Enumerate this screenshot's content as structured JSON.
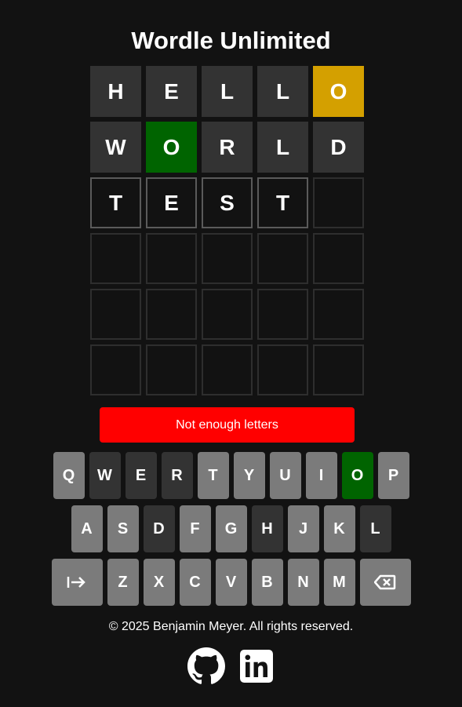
{
  "title": "Wordle Unlimited",
  "board": [
    [
      {
        "l": "H",
        "s": "absent"
      },
      {
        "l": "E",
        "s": "absent"
      },
      {
        "l": "L",
        "s": "absent"
      },
      {
        "l": "L",
        "s": "absent"
      },
      {
        "l": "O",
        "s": "present"
      }
    ],
    [
      {
        "l": "W",
        "s": "absent"
      },
      {
        "l": "O",
        "s": "correct"
      },
      {
        "l": "R",
        "s": "absent"
      },
      {
        "l": "L",
        "s": "absent"
      },
      {
        "l": "D",
        "s": "absent"
      }
    ],
    [
      {
        "l": "T",
        "s": "typed"
      },
      {
        "l": "E",
        "s": "typed"
      },
      {
        "l": "S",
        "s": "typed"
      },
      {
        "l": "T",
        "s": "typed"
      },
      {
        "l": "",
        "s": "empty"
      }
    ],
    [
      {
        "l": "",
        "s": "empty"
      },
      {
        "l": "",
        "s": "empty"
      },
      {
        "l": "",
        "s": "empty"
      },
      {
        "l": "",
        "s": "empty"
      },
      {
        "l": "",
        "s": "empty"
      }
    ],
    [
      {
        "l": "",
        "s": "empty"
      },
      {
        "l": "",
        "s": "empty"
      },
      {
        "l": "",
        "s": "empty"
      },
      {
        "l": "",
        "s": "empty"
      },
      {
        "l": "",
        "s": "empty"
      }
    ],
    [
      {
        "l": "",
        "s": "empty"
      },
      {
        "l": "",
        "s": "empty"
      },
      {
        "l": "",
        "s": "empty"
      },
      {
        "l": "",
        "s": "empty"
      },
      {
        "l": "",
        "s": "empty"
      }
    ]
  ],
  "message": "Not enough letters",
  "keyboard": {
    "row1": [
      {
        "k": "Q",
        "s": "unused"
      },
      {
        "k": "W",
        "s": "absent"
      },
      {
        "k": "E",
        "s": "absent"
      },
      {
        "k": "R",
        "s": "absent"
      },
      {
        "k": "T",
        "s": "unused"
      },
      {
        "k": "Y",
        "s": "unused"
      },
      {
        "k": "U",
        "s": "unused"
      },
      {
        "k": "I",
        "s": "unused"
      },
      {
        "k": "O",
        "s": "correct"
      },
      {
        "k": "P",
        "s": "unused"
      }
    ],
    "row2": [
      {
        "k": "A",
        "s": "unused"
      },
      {
        "k": "S",
        "s": "unused"
      },
      {
        "k": "D",
        "s": "absent"
      },
      {
        "k": "F",
        "s": "unused"
      },
      {
        "k": "G",
        "s": "unused"
      },
      {
        "k": "H",
        "s": "absent"
      },
      {
        "k": "J",
        "s": "unused"
      },
      {
        "k": "K",
        "s": "unused"
      },
      {
        "k": "L",
        "s": "absent"
      }
    ],
    "row3": [
      {
        "k": "Z",
        "s": "unused"
      },
      {
        "k": "X",
        "s": "unused"
      },
      {
        "k": "C",
        "s": "unused"
      },
      {
        "k": "V",
        "s": "unused"
      },
      {
        "k": "B",
        "s": "unused"
      },
      {
        "k": "N",
        "s": "unused"
      },
      {
        "k": "M",
        "s": "unused"
      }
    ],
    "enter_icon": "enter-arrow-icon",
    "backspace_icon": "backspace-icon"
  },
  "footer": "© 2025 Benjamin Meyer. All rights reserved.",
  "socials": [
    {
      "icon": "github-icon"
    },
    {
      "icon": "linkedin-icon"
    }
  ],
  "colors": {
    "background": "#121212",
    "absent": "#333333",
    "present": "#d4a000",
    "correct": "#006400",
    "unused_key": "#7b7b7b",
    "message_bg": "#ff0000"
  }
}
